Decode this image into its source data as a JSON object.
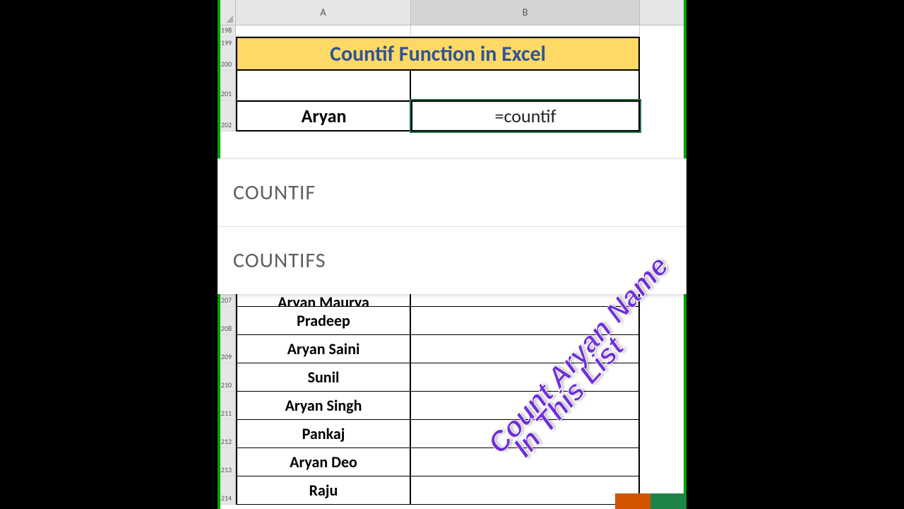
{
  "columns": {
    "a": "A",
    "b": "B"
  },
  "thin_rows": [
    "198",
    "199",
    "200"
  ],
  "title_row_num": "200",
  "title": "Countif Function in Excel",
  "gap_row_num": "201",
  "input_row_num": "202",
  "input_label": "Aryan",
  "input_formula": "=countif",
  "autocomplete": [
    "COUNTIF",
    "COUNTIFS"
  ],
  "data_rows": [
    {
      "num": "207",
      "name": "Aryan Maurya"
    },
    {
      "num": "208",
      "name": "Pradeep"
    },
    {
      "num": "209",
      "name": "Aryan Saini"
    },
    {
      "num": "210",
      "name": "Sunil"
    },
    {
      "num": "211",
      "name": "Aryan Singh"
    },
    {
      "num": "212",
      "name": "Pankaj"
    },
    {
      "num": "213",
      "name": "Aryan Deo"
    },
    {
      "num": "214",
      "name": "Raju"
    }
  ],
  "overlay": {
    "line1": "Count Aryan Name",
    "line2": "In This List"
  }
}
